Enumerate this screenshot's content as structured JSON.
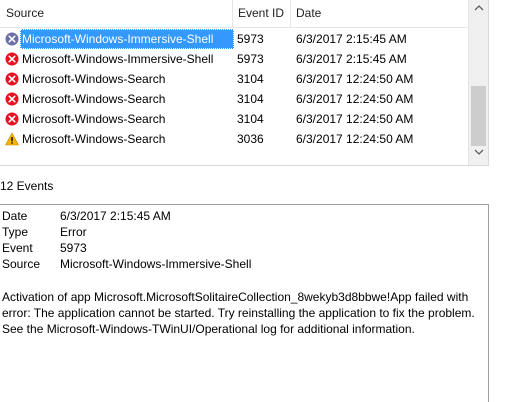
{
  "columns": {
    "source": "Source",
    "event_id": "Event ID",
    "date": "Date"
  },
  "rows": [
    {
      "level": "error-selected",
      "source": "Microsoft-Windows-Immersive-Shell",
      "event_id": "5973",
      "date": "6/3/2017 2:15:45 AM"
    },
    {
      "level": "error",
      "source": "Microsoft-Windows-Immersive-Shell",
      "event_id": "5973",
      "date": "6/3/2017 2:15:45 AM"
    },
    {
      "level": "error",
      "source": "Microsoft-Windows-Search",
      "event_id": "3104",
      "date": "6/3/2017 12:24:50 AM"
    },
    {
      "level": "error",
      "source": "Microsoft-Windows-Search",
      "event_id": "3104",
      "date": "6/3/2017 12:24:50 AM"
    },
    {
      "level": "error",
      "source": "Microsoft-Windows-Search",
      "event_id": "3104",
      "date": "6/3/2017 12:24:50 AM"
    },
    {
      "level": "warning",
      "source": "Microsoft-Windows-Search",
      "event_id": "3036",
      "date": "6/3/2017 12:24:50 AM"
    }
  ],
  "event_count": "12 Events",
  "details": {
    "date_label": "Date",
    "date_value": "6/3/2017 2:15:45 AM",
    "type_label": "Type",
    "type_value": "Error",
    "event_label": "Event",
    "event_value": "5973",
    "source_label": "Source",
    "source_value": "Microsoft-Windows-Immersive-Shell",
    "message": "Activation of app Microsoft.MicrosoftSolitaireCollection_8wekyb3d8bbwe!App failed with error: The application cannot be started. Try reinstalling the application to fix the problem. See the Microsoft-Windows-TWinUI/Operational log for additional information."
  },
  "icons": {
    "error": "error-icon",
    "warning": "warning-icon",
    "scroll_up": "chevron-up-icon",
    "scroll_down": "chevron-down-icon"
  },
  "colors": {
    "selection": "#3399ff",
    "error": "#e81123",
    "warning": "#f4b400",
    "error_selected": "#6b6fa8"
  }
}
